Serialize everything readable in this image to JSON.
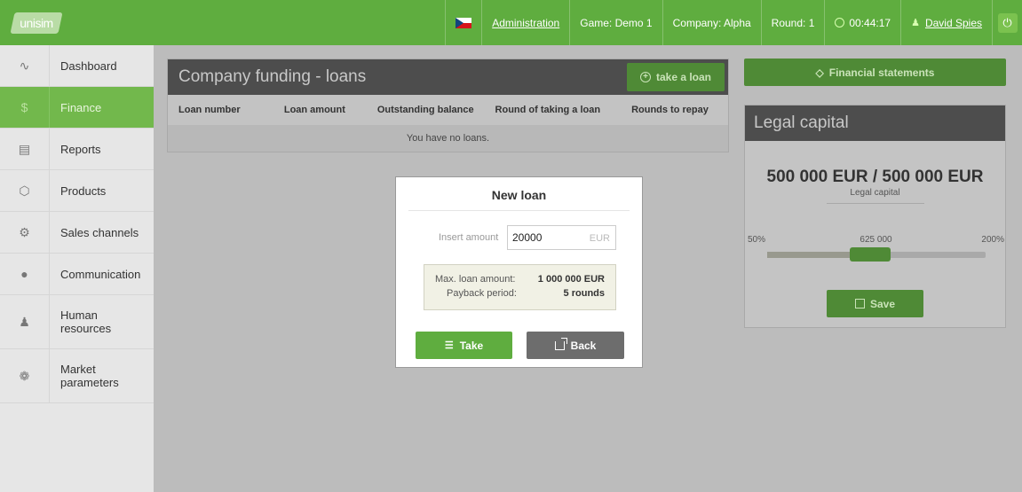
{
  "app": {
    "logo_text": "unisim"
  },
  "topbar": {
    "flag_icon": "czech-flag-icon",
    "administration": "Administration",
    "game": "Game: Demo 1",
    "company": "Company: Alpha",
    "round": "Round: 1",
    "timer": "00:44:17",
    "user": "David Spies",
    "power_icon": "power-icon",
    "accent_color": "#5fad3f"
  },
  "sidebar": {
    "items": [
      {
        "label": "Dashboard",
        "icon": "chart-line-icon"
      },
      {
        "label": "Finance",
        "icon": "dollar-icon",
        "active": true
      },
      {
        "label": "Reports",
        "icon": "clipboard-icon"
      },
      {
        "label": "Products",
        "icon": "box-icon"
      },
      {
        "label": "Sales channels",
        "icon": "sitemap-icon"
      },
      {
        "label": "Communication",
        "icon": "comments-icon"
      },
      {
        "label": "Human resources",
        "icon": "people-icon"
      },
      {
        "label": "Market parameters",
        "icon": "gear-icon"
      }
    ]
  },
  "loans": {
    "title": "Company funding - loans",
    "take_loan_label": "take a loan",
    "columns": [
      "Loan number",
      "Loan amount",
      "Outstanding balance",
      "Round of taking a loan",
      "Rounds to repay"
    ],
    "empty_message": "You have no loans."
  },
  "financial_statements": {
    "label": "Financial statements"
  },
  "legal_capital": {
    "title": "Legal capital",
    "value": "500 000 EUR / 500 000 EUR",
    "subtitle": "Legal capital",
    "slider": {
      "min_label": "50%",
      "mid_label": "625 000",
      "max_label": "200%",
      "value_fraction": 0.47
    },
    "save_label": "Save"
  },
  "modal": {
    "title": "New loan",
    "amount_label": "Insert amount",
    "amount_value": "20000",
    "amount_unit": "EUR",
    "max_loan_label": "Max. loan amount:",
    "max_loan_value": "1 000 000 EUR",
    "payback_label": "Payback period:",
    "payback_value": "5 rounds",
    "take_label": "Take",
    "back_label": "Back"
  }
}
